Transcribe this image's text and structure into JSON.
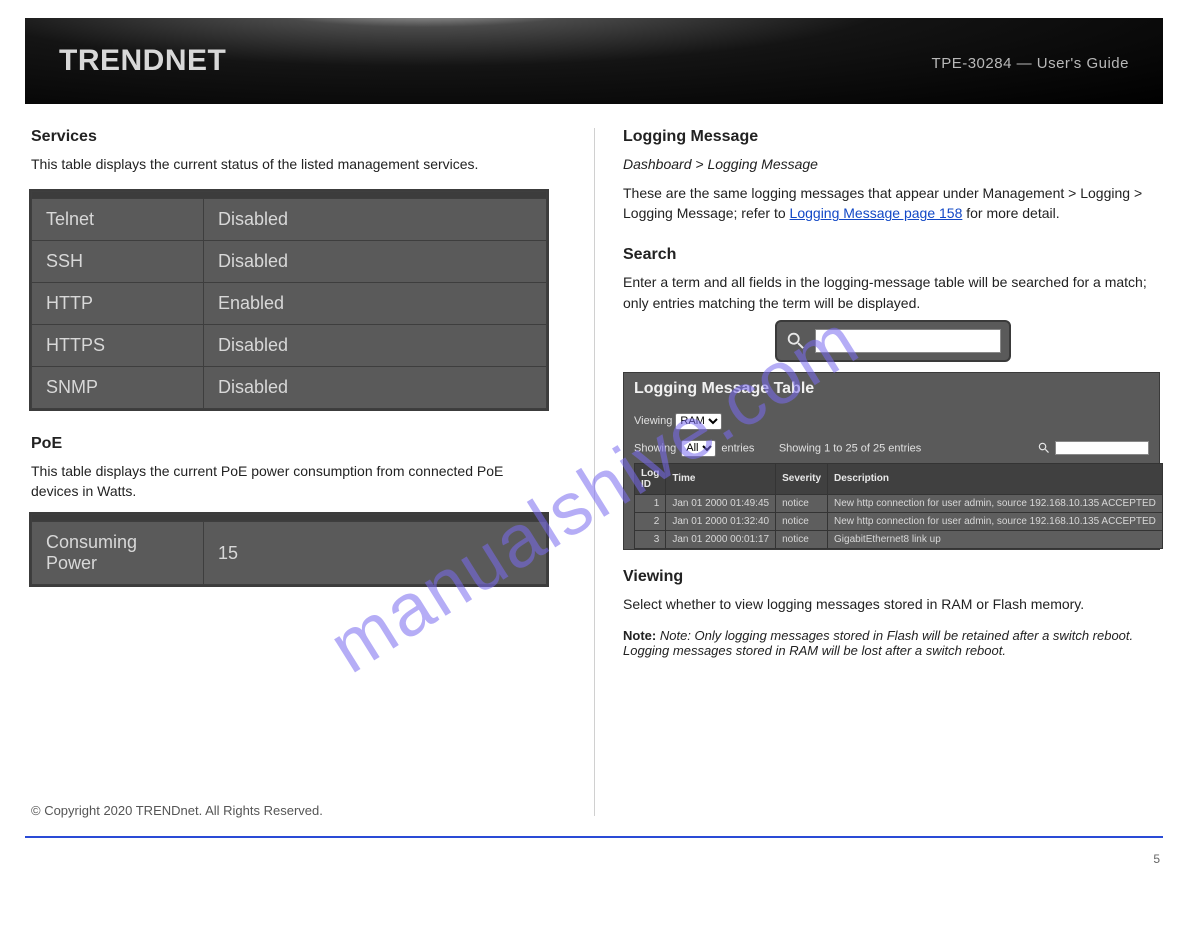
{
  "banner": {
    "brand": "TRENDNET",
    "model": "TPE-30284 — User's Guide"
  },
  "left": {
    "services_section": "Services",
    "services_intro": "This table displays the current status of the listed management services.",
    "services": [
      {
        "name": "Telnet",
        "state": "Disabled"
      },
      {
        "name": "SSH",
        "state": "Disabled"
      },
      {
        "name": "HTTP",
        "state": "Enabled"
      },
      {
        "name": "HTTPS",
        "state": "Disabled"
      },
      {
        "name": "SNMP",
        "state": "Disabled"
      }
    ],
    "poe_section": "PoE",
    "poe_intro": "This table displays the current PoE power consumption from connected PoE devices in Watts.",
    "poe": {
      "label": "Consuming Power",
      "value": "15"
    },
    "copyright": "© Copyright 2020 TRENDnet. All Rights Reserved."
  },
  "right": {
    "logging_section": "Logging Message",
    "nav": "Dashboard > Logging Message",
    "logging_intro_pre": "These are the same logging messages that appear under Management > Logging > Logging Message; refer to ",
    "logging_link": "Logging Message page 158",
    "logging_intro_post": " for more detail.",
    "search_label": "Search",
    "search_desc": "Enter a term and all fields in the logging-message table will be searched for a match; only entries matching the term will be displayed.",
    "logbox": {
      "title": "Logging Message Table",
      "viewing_label": "Viewing",
      "viewing_value": "RAM",
      "showing_label": "Showing",
      "showing_select": "All",
      "showing_suffix": "entries",
      "range": "Showing 1 to 25 of 25 entries",
      "headers": {
        "id": "Log ID",
        "time": "Time",
        "sev": "Severity",
        "desc": "Description"
      },
      "rows": [
        {
          "id": "1",
          "time": "Jan 01 2000 01:49:45",
          "sev": "notice",
          "desc": "New http connection for user admin, source 192.168.10.135 ACCEPTED"
        },
        {
          "id": "2",
          "time": "Jan 01 2000 01:32:40",
          "sev": "notice",
          "desc": "New http connection for user admin, source 192.168.10.135 ACCEPTED"
        },
        {
          "id": "3",
          "time": "Jan 01 2000 00:01:17",
          "sev": "notice",
          "desc": "GigabitEthernet8 link up"
        }
      ]
    },
    "viewing_section": "Viewing",
    "viewing_desc": "Select whether to view logging messages stored in RAM or Flash memory.",
    "note": "Note: Only logging messages stored in Flash will be retained after a switch reboot. Logging messages stored in RAM will be lost after a switch reboot."
  },
  "footer": {
    "left": "",
    "right": "5"
  },
  "watermark": "manualshive.com"
}
